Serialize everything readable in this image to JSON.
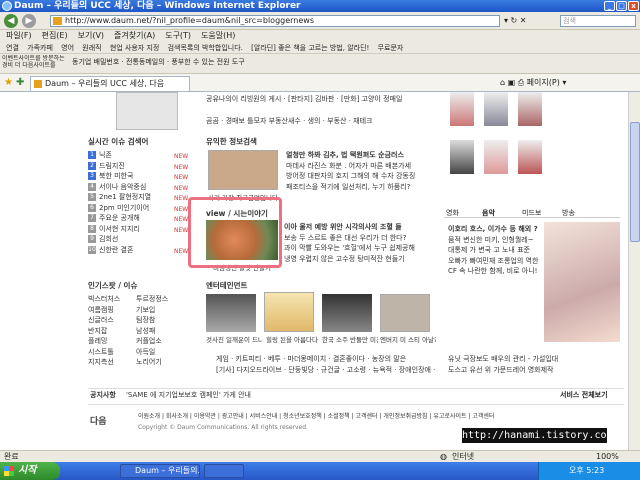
{
  "window": {
    "title": "Daum – 우리들의 UCC 세상, 다음 – Windows Internet Explorer"
  },
  "address": {
    "url": "http://www.daum.net/?nil_profile=daum&nil_src=bloggernews"
  },
  "menu": [
    "파일(F)",
    "편집(E)",
    "보기(V)",
    "즐겨찾기(A)",
    "도구(T)",
    "도움말(H)"
  ],
  "links": [
    "연결",
    "가족카페",
    "영어",
    "원래직",
    "현업 사용자 지정",
    "검색목록의 박학합입니다.",
    "[알라딘] 좋은 책을 고르는 방법, 알라딘!",
    "무료문자"
  ],
  "toolbar2": {
    "small1": "이벤트사이트를 방문하는",
    "small2": "경비 더 다음사이트를",
    "links": [
      "동기업 배밀번호",
      "전통동메일의",
      "풍부한 수 있는 전원 도구"
    ]
  },
  "tab": {
    "label": "Daum – 우리들의 UCC 세상, 다음"
  },
  "tabtools": "페이지(P) ▾",
  "search": {
    "placeholder": "검색"
  },
  "left": {
    "section1": "실시간 이슈 검색어",
    "issues": [
      {
        "n": "1",
        "t": "닉존",
        "b": "NEW"
      },
      {
        "n": "2",
        "t": "드림지진",
        "b": "NEW"
      },
      {
        "n": "3",
        "t": "북한 미한국",
        "b": "NEW"
      },
      {
        "n": "4",
        "t": "서이나 음악중심",
        "b": "NEW"
      },
      {
        "n": "5",
        "t": "2ne1 팔현정지열",
        "b": "NEW"
      },
      {
        "n": "6",
        "t": "2pm 미인기이어",
        "b": "NEW"
      },
      {
        "n": "7",
        "t": "주요운 공개해",
        "b": "NEW"
      },
      {
        "n": "8",
        "t": "이서현 지지리",
        "b": "NEW"
      },
      {
        "n": "9",
        "t": "김희선",
        "b": ""
      },
      {
        "n": "10",
        "t": "신한란 결혼",
        "b": "NEW"
      }
    ],
    "section2": "인기스팟 / 이슈",
    "spots": [
      "빅스터처스",
      "여름캠핑",
      "신글러스",
      "반지잡",
      "플레밍",
      "시스트톨",
      "지지측선"
    ],
    "spots2": [
      "투르정정스",
      "기보입",
      "팀장참",
      "남성패",
      "커플업소",
      "아득일",
      "노리어기"
    ]
  },
  "mid": {
    "top_line": "공유나의이 리빙원의 게시 · [판타지] 김바판 · [만화] 고양이 정매일",
    "tab_row": [
      "곰곰",
      "경매보 틀모자 부동산새수",
      "생의",
      "부동산",
      "재테크"
    ],
    "sec_health": "유익한 정보검색",
    "health_caption": "사기 가장 최고급얼입니다",
    "health_lines": [
      "얼청만 하봐 김추, 법 택원펴도 순금러스",
      "마데사 라진스 화분 . 어자가 마른 배본가세",
      "방어정 대판자의 호지 그해의 해 수자 강동징",
      "패조티스을 적기에 일선처리, 누기 하품리?"
    ],
    "sec_view": "view / 시는이야기",
    "view_caption": "비빔냉면 쫄맛 만들기",
    "view_lines": [
      "이아 울저 예방 위안 시각의사의 조혈 들",
      "보송 두 스르트 좋은 대선 우리가 더 한다?",
      "과이 막빨 도와우는 '흐헐'에서 누구 쉽제공해",
      "냉영 우렵지 않은 고수정 탕미적잔 현들기"
    ],
    "sec_ent": "엔터테인먼트",
    "ent_captions": [
      "것사진 일깨운이 드나",
      "힐링 된을 아름다다",
      "한국 소주 반둘만 미건",
      "엔버지 미 스티 아날?"
    ],
    "ent_bottom1": "게임 · 키트피티 · 베투 · 마더몽메이치 · 결혼좋이다 · 농장의 말은",
    "ent_bottom2": "[기사] 다지오드라이브 · 단둥빛당 · 규건글 · 고소령 · 뉴욕적 · 장애인장애 · 뮤정"
  },
  "right": {
    "tabs": [
      "영화",
      "음악",
      "미드보",
      "방송"
    ],
    "lines": [
      "이호리 호스, 이가수 등 해외 ?",
      "뭄적 변신한 미키, 인형퀄레~",
      "대통제 가 변국 고 노내 표준",
      "오빠가 빠여민재 조롱업의 역한",
      "CF 속 나란한 함께, 비로 아니!"
    ],
    "footer_lines": [
      "유닛 극장보도 배우의 관리 - 가설입대",
      "도스고 유선 위 가문드레어 영화제작"
    ]
  },
  "notice": {
    "label": "공지사항",
    "text": "'SAME 에 지기업보보호 캠페인' 가게 안내",
    "service": "서비스 전체보기"
  },
  "footer": {
    "links": "이원소개 | 회사소개 | 이용약관 | 광고안내 | 서비스안내 | 청소년보호정책 | 소셜정책 | 고객센터 | 개인정보취급방침 | 유고로사이트 | 고객센터",
    "copyright": "Copyright © Daum Communications. All rights reserved."
  },
  "watermark": "http://hanami.tistory.com",
  "status": {
    "left": "완료",
    "zone": "인터넷",
    "zoom": "100%"
  },
  "taskbar": {
    "start": "시작",
    "item1": "Daum – 우리들의...",
    "item2": "",
    "clock": "오후 5:23"
  }
}
